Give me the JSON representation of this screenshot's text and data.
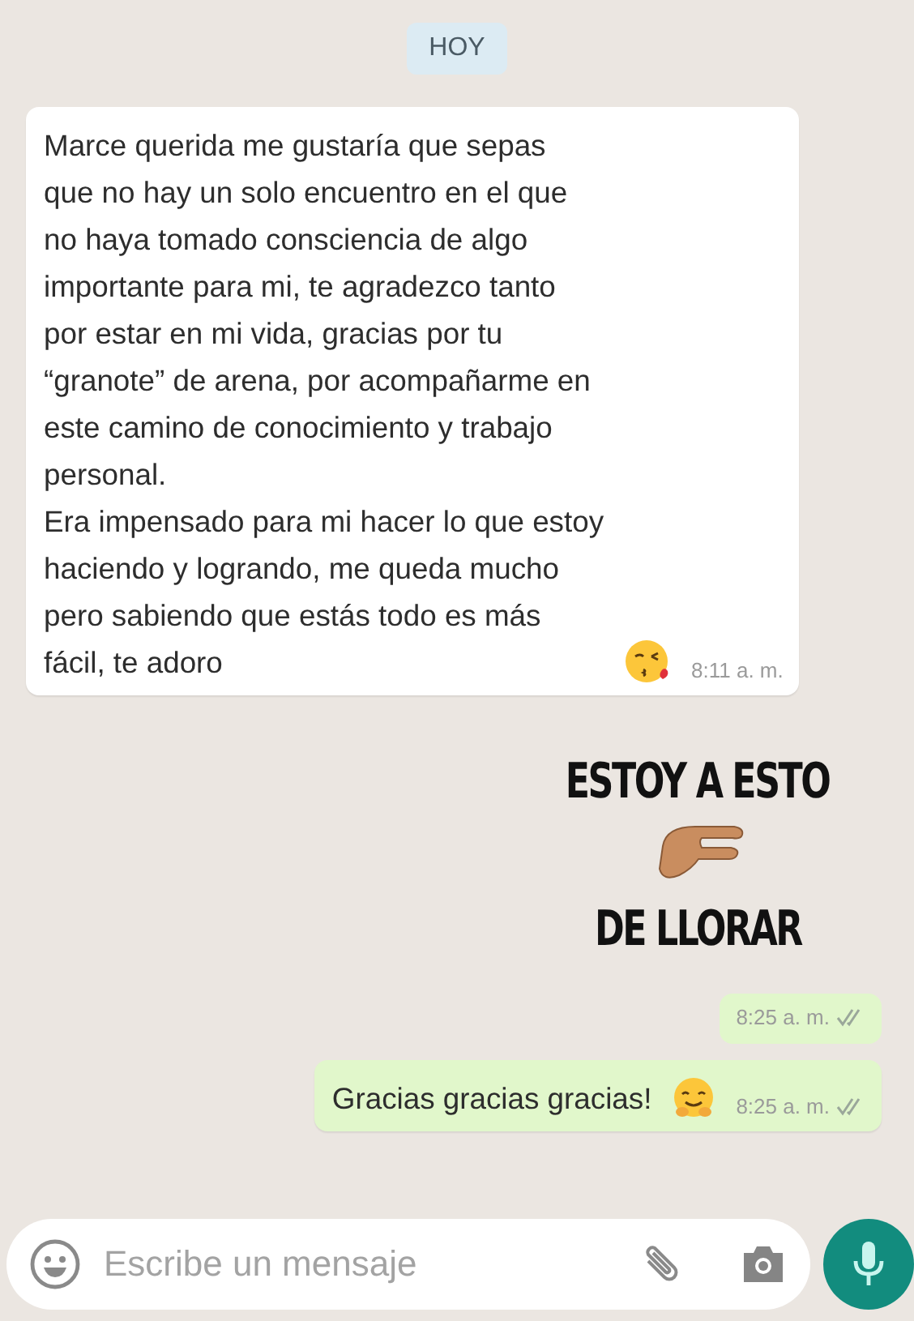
{
  "date_chip": "HOY",
  "messages": [
    {
      "kind": "text",
      "outgoing": false,
      "text": "Marce querida me gustaría que sepas\nque no hay un solo encuentro en el que\nno haya tomado consciencia de algo\nimportante para mi, te agradezco tanto\npor estar en mi vida, gracias por tu\n“granote” de arena, por acompañarme en\neste camino de conocimiento y trabajo\npersonal.\nEra impensado para mi hacer lo que estoy\nhaciendo y logrando, me queda mucho\npero sabiendo que estás todo es más\nfácil, te adoro",
      "emoji": {
        "kind": "kiss"
      },
      "time": "8:11 a. m."
    },
    {
      "kind": "sticker",
      "outgoing": true,
      "lines": [
        "ESTOY A ESTO",
        "DE LLORAR"
      ],
      "time": "8:25 a. m.",
      "read": false
    },
    {
      "kind": "text",
      "outgoing": true,
      "text": "Gracias gracias gracias!",
      "emoji": {
        "kind": "hug"
      },
      "time": "8:25 a. m.",
      "read": false
    }
  ],
  "composer": {
    "placeholder": "Escribe un mensaje"
  }
}
